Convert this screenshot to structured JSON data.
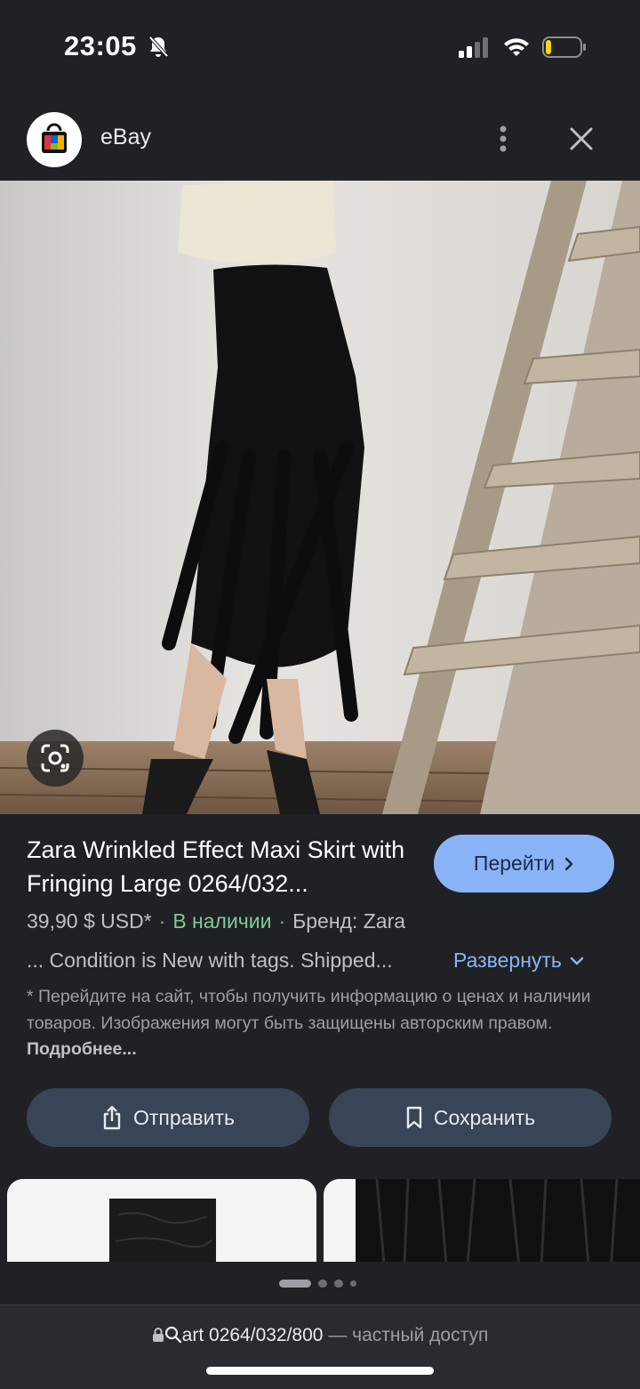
{
  "status_bar": {
    "time": "23:05",
    "icons": [
      "bell-slash-icon",
      "cellular-signal-icon",
      "wifi-icon",
      "battery-low-icon"
    ]
  },
  "header": {
    "site_name": "eBay",
    "logo_icon": "shopping-bag-logo",
    "more_icon": "more-vertical-icon",
    "close_icon": "close-icon"
  },
  "lens_icon": "google-lens-icon",
  "product": {
    "title": "Zara Wrinkled Effect Maxi Skirt with Fringing Large 0264/032...",
    "goto_label": "Перейти",
    "price": "39,90 $ USD*",
    "separator": "·",
    "availability": "В наличии",
    "brand": "Бренд: Zara",
    "snippet": "... Condition is New with tags. Shipped...",
    "expand_label": "Развернуть",
    "disclaimer": "* Перейдите на сайт, чтобы получить информацию о ценах и наличии товаров. Изображения могут быть защищены авторским правом.",
    "more_link": "Подробнее..."
  },
  "actions": {
    "share_label": "Отправить",
    "save_label": "Сохранить"
  },
  "colors": {
    "background": "#202124",
    "accent": "#8ab4f8",
    "in_stock": "#81c995",
    "action_button": "#394457"
  },
  "url_bar": {
    "url": "art 0264/032/800",
    "suffix": "— частный доступ",
    "icons": [
      "lock-icon",
      "search-icon"
    ]
  }
}
